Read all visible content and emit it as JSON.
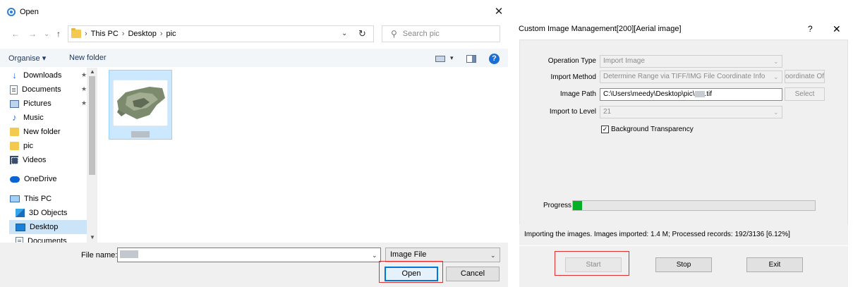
{
  "open_dialog": {
    "title": "Open",
    "close_glyph": "✕",
    "nav": {
      "back": "←",
      "forward": "→",
      "recent": "⌄",
      "up": "↑"
    },
    "breadcrumb": [
      "This PC",
      "Desktop",
      "pic"
    ],
    "breadcrumb_sep": "›",
    "search_placeholder": "Search pic",
    "toolbar": {
      "organise": "Organise ▾",
      "new_folder": "New folder"
    },
    "help_glyph": "?",
    "sidebar": [
      {
        "label": "Downloads",
        "icon": "download-icon",
        "pinned": true
      },
      {
        "label": "Documents",
        "icon": "document-icon",
        "pinned": true
      },
      {
        "label": "Pictures",
        "icon": "pictures-icon",
        "pinned": true
      },
      {
        "label": "Music",
        "icon": "music-icon",
        "pinned": false
      },
      {
        "label": "New folder",
        "icon": "folder-icon",
        "pinned": false
      },
      {
        "label": "pic",
        "icon": "folder-icon",
        "pinned": false
      },
      {
        "label": "Videos",
        "icon": "video-icon",
        "pinned": false
      },
      {
        "label": "OneDrive",
        "icon": "cloud-icon",
        "pinned": false
      },
      {
        "label": "This PC",
        "icon": "computer-icon",
        "pinned": false
      },
      {
        "label": "3D Objects",
        "icon": "3d-objects-icon",
        "pinned": false
      },
      {
        "label": "Desktop",
        "icon": "desktop-icon",
        "pinned": false,
        "selected": true
      },
      {
        "label": "Documents",
        "icon": "document-icon",
        "pinned": false
      }
    ],
    "pin_glyph": "📌",
    "file_name_label": "File name:",
    "file_type": "Image File",
    "open_button": "Open",
    "cancel_button": "Cancel"
  },
  "cim": {
    "title": "Custom Image Management[200][Aerial image]",
    "help_glyph": "?",
    "close_glyph": "✕",
    "operation_type_label": "Operation Type",
    "operation_type_value": "Import Image",
    "import_method_label": "Import Method",
    "import_method_value": "Determine Range via TIFF/IMG File Coordinate Info",
    "coordinate_button": "oordinate Offs",
    "image_path_label": "Image Path",
    "image_path_value": "C:\\Users\\meedy\\Desktop\\pic\\",
    "image_path_ext": ".tif",
    "select_button": "Select",
    "import_level_label": "Import to Level",
    "import_level_value": "21",
    "background_transparency_label": "Background Transparency",
    "background_transparency_checked": true,
    "check_glyph": "✓",
    "progress_label": "Progress",
    "progress_fraction": 0.0612,
    "status_text": "Importing the images. Images imported: 1.4 M; Processed records: 192/3136 [6.12%]",
    "start_button": "Start",
    "stop_button": "Stop",
    "exit_button": "Exit"
  },
  "colors": {
    "accent_blue": "#0078d7",
    "highlight_red": "#e03030",
    "progress_green": "#06b025"
  }
}
